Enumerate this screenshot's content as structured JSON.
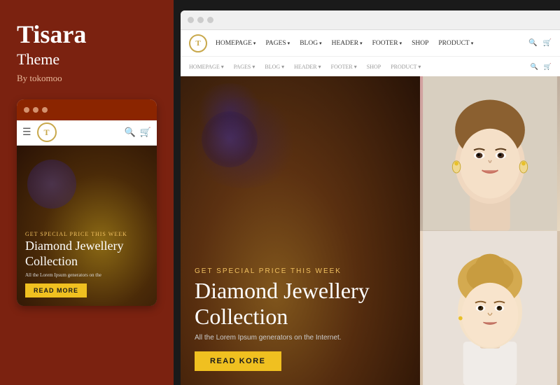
{
  "left": {
    "brand": {
      "title": "Tisara",
      "subtitle": "Theme",
      "byline": "By tokomoo"
    },
    "mobile": {
      "dots": [
        "dot1",
        "dot2",
        "dot3"
      ],
      "logo": "T",
      "hero": {
        "special_text": "GET SPECIAL PRICE THIS WEEK",
        "title": "Diamond Jewellery Collection",
        "description": "All the Lorem Ipsum generators on the",
        "read_more": "READ MORE"
      }
    }
  },
  "right": {
    "browser": {
      "dots": [
        "dot1",
        "dot2",
        "dot3"
      ]
    },
    "navbar": {
      "logo": "T",
      "items": [
        {
          "label": "HOMEPAGE",
          "has_arrow": true
        },
        {
          "label": "PAGES",
          "has_arrow": true
        },
        {
          "label": "BLOG",
          "has_arrow": true
        },
        {
          "label": "HEADER",
          "has_arrow": true
        },
        {
          "label": "FOOTER",
          "has_arrow": true
        },
        {
          "label": "SHOP",
          "has_arrow": false
        },
        {
          "label": "PRODUCT",
          "has_arrow": true
        }
      ]
    },
    "hero": {
      "special_text": "GET SPECIAL PRICE THIS WEEK",
      "title": "Diamond Jewellery Collection",
      "description": "All the Lorem Ipsum generators on the Internet.",
      "read_more": "Read KORE"
    }
  }
}
